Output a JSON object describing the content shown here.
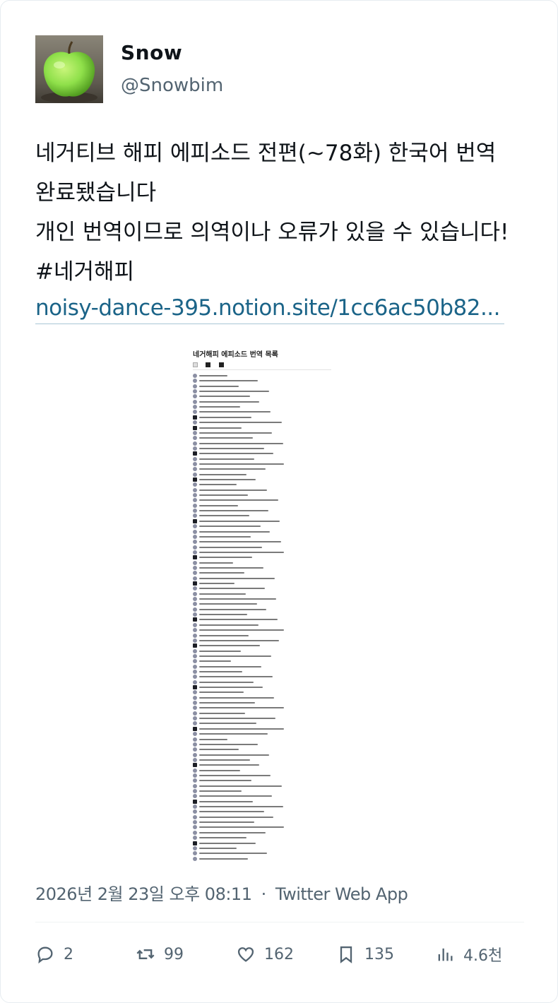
{
  "author": {
    "name": "Snow",
    "handle": "@Snowbim"
  },
  "tweet": {
    "lines": [
      "네거티브 해피 에피소드 전편(~78화) 한국어 번역",
      "완료됐습니다",
      "개인 번역이므로 의역이나 오류가 있을 수 있습니다!",
      "#네거해피"
    ],
    "link": "noisy-dance-395.notion.site/1cc6ac50b82..."
  },
  "media": {
    "title": "네거해피 에피소드 번역 목록",
    "row_count": 94
  },
  "meta": {
    "timestamp": "2026년 2월 23일 오후 08:11",
    "separator": "·",
    "source": "Twitter Web App"
  },
  "actions": {
    "replies": "2",
    "retweets": "99",
    "likes": "162",
    "bookmarks": "135",
    "views": "4.6천"
  },
  "colors": {
    "link": "#1b6488",
    "muted": "#536471",
    "apple": "#8fe04a"
  }
}
